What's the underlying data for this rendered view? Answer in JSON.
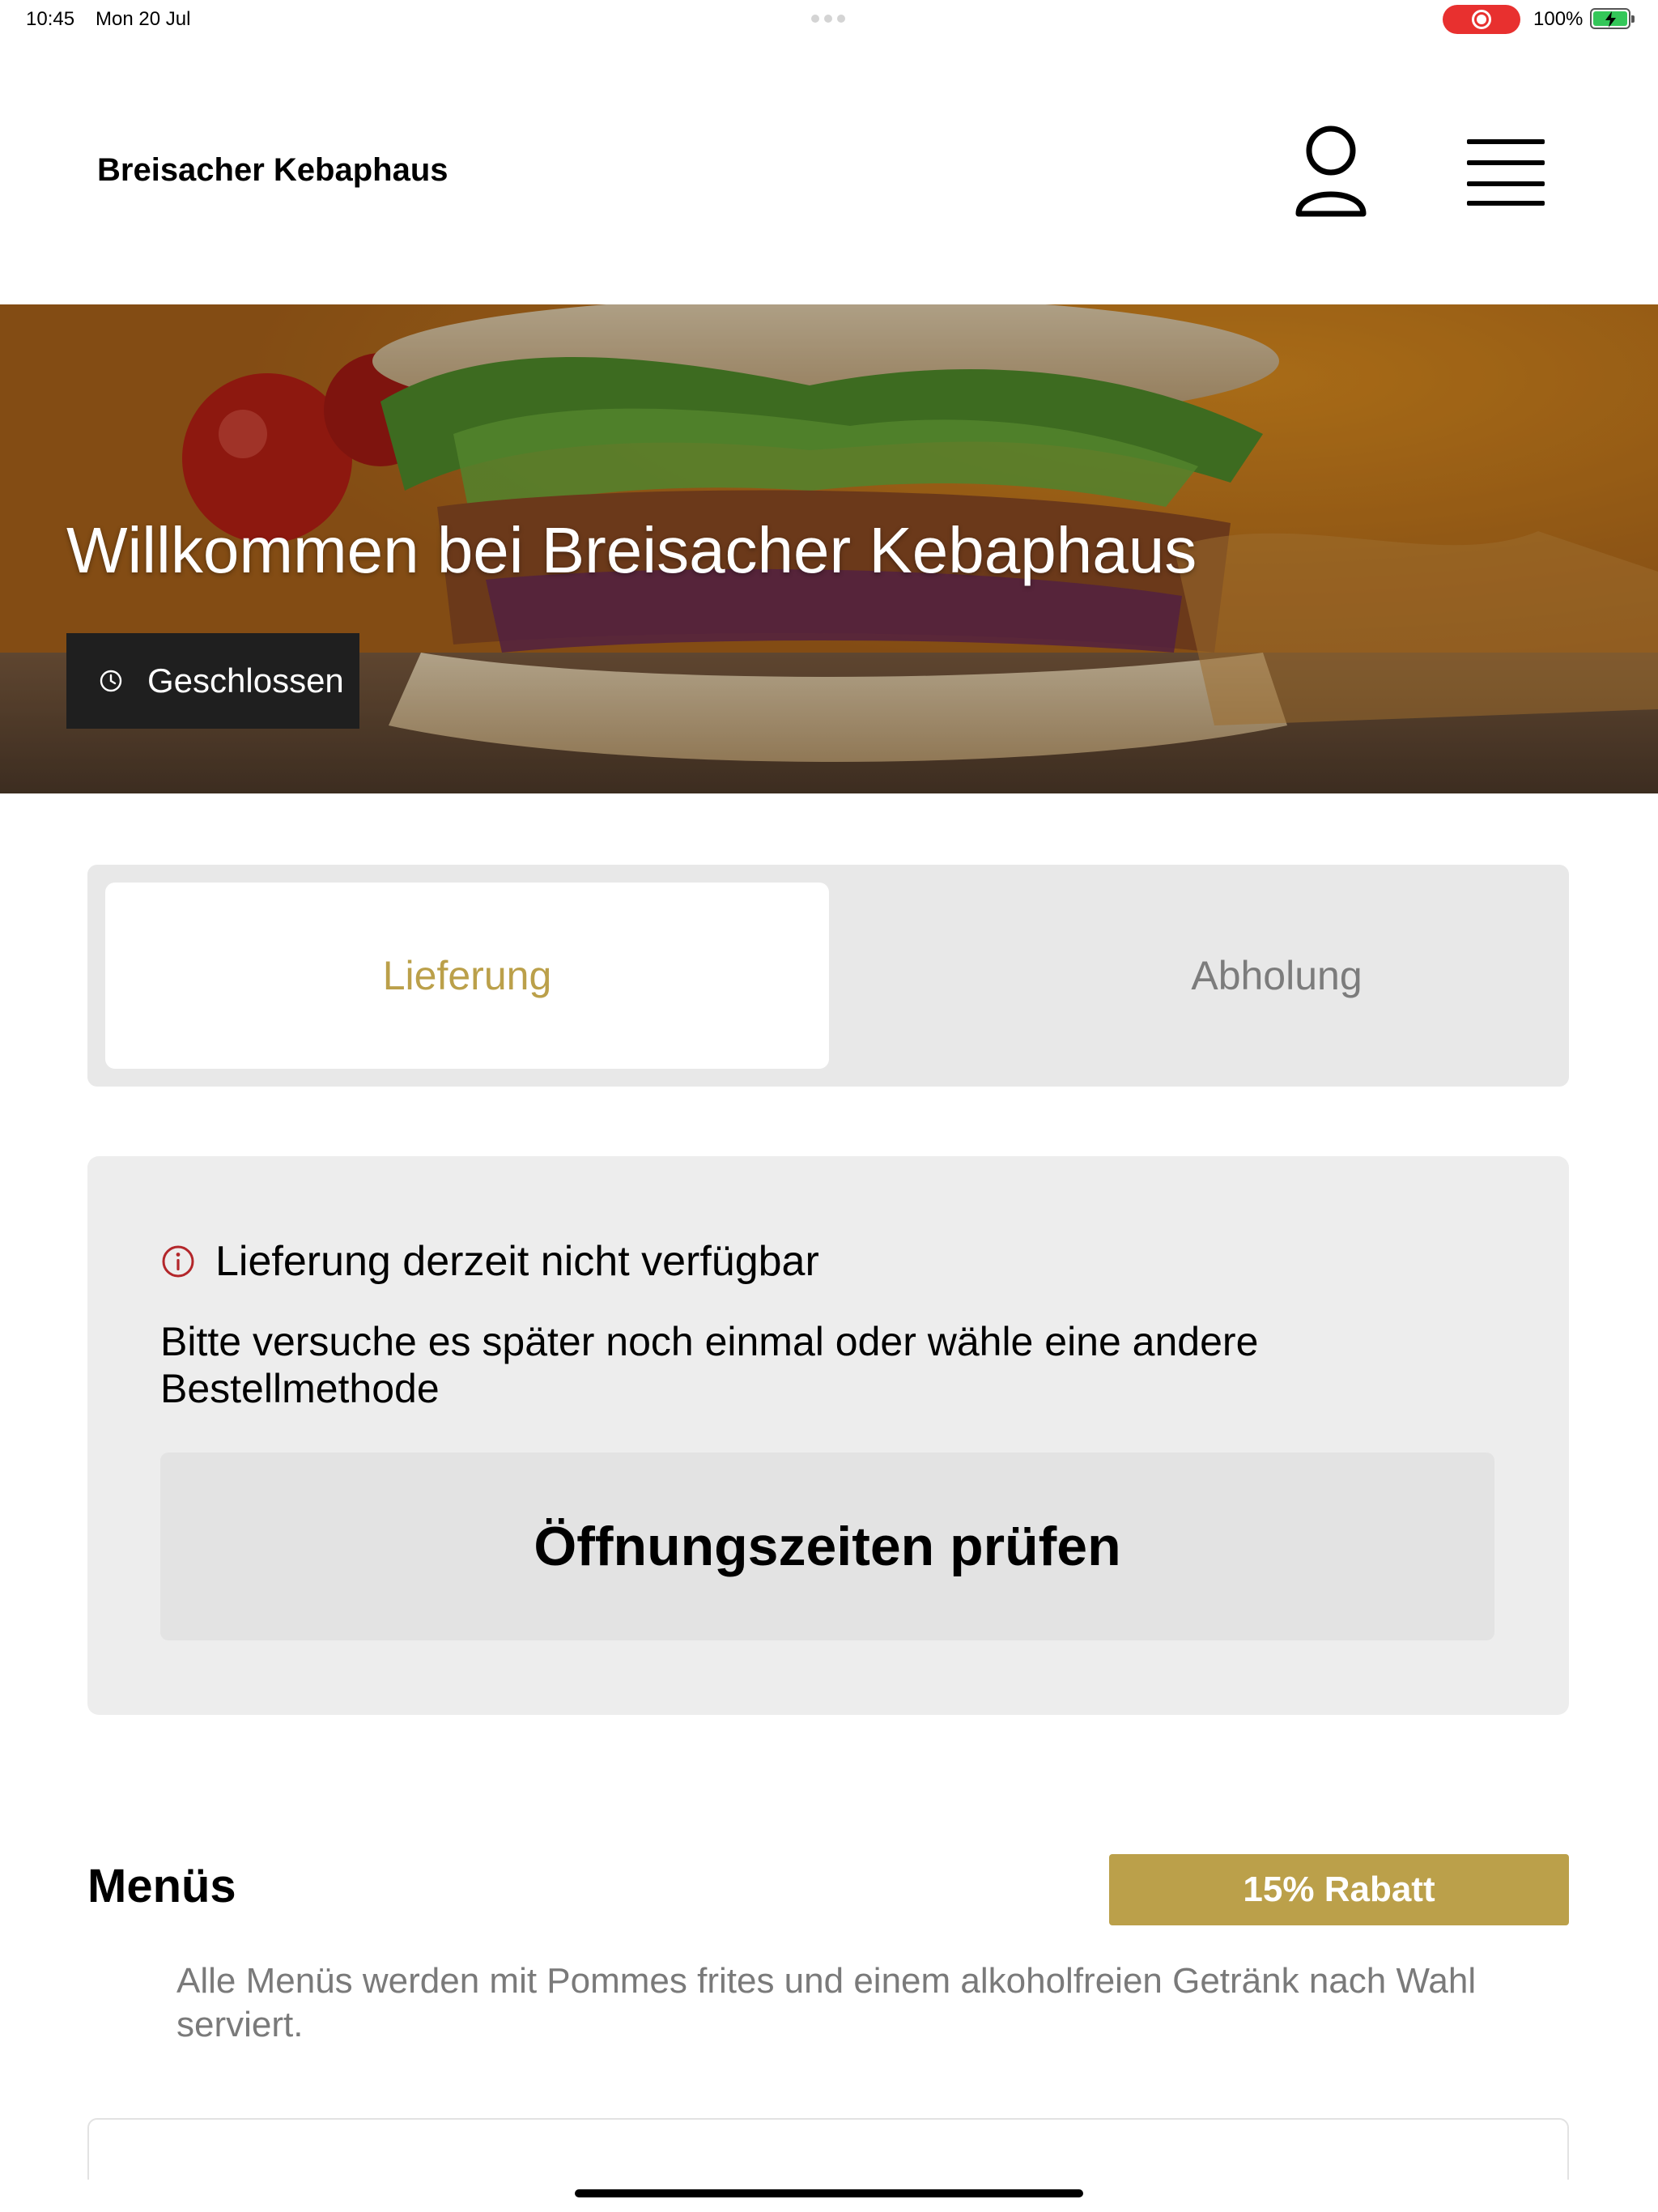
{
  "status_bar": {
    "time": "10:45",
    "date": "Mon 20 Jul",
    "battery": "100%",
    "record_color": "#e8302f",
    "battery_color": "#34c759"
  },
  "header": {
    "brand": "Breisacher Kebaphaus",
    "user_icon": "user-icon",
    "menu_icon": "hamburger-menu-icon"
  },
  "hero": {
    "title": "Willkommen bei Breisacher Kebaphaus",
    "status_label": "Geschlossen",
    "status_icon": "clock-icon"
  },
  "order_mode": {
    "delivery": "Lieferung",
    "pickup": "Abholung",
    "selected": "Lieferung",
    "accent_color": "#bba04a"
  },
  "notice": {
    "icon": "info-icon",
    "icon_color": "#b3262a",
    "title": "Lieferung derzeit nicht verfügbar",
    "text": "Bitte versuche es später noch einmal oder wähle eine andere Bestellmethode",
    "button": "Öffnungszeiten prüfen"
  },
  "menus_section": {
    "title": "Menüs",
    "discount": "15% Rabatt",
    "discount_color": "#bba04a",
    "description": "Alle Menüs werden mit Pommes frites und einem alkoholfreien Getränk nach Wahl serviert."
  }
}
